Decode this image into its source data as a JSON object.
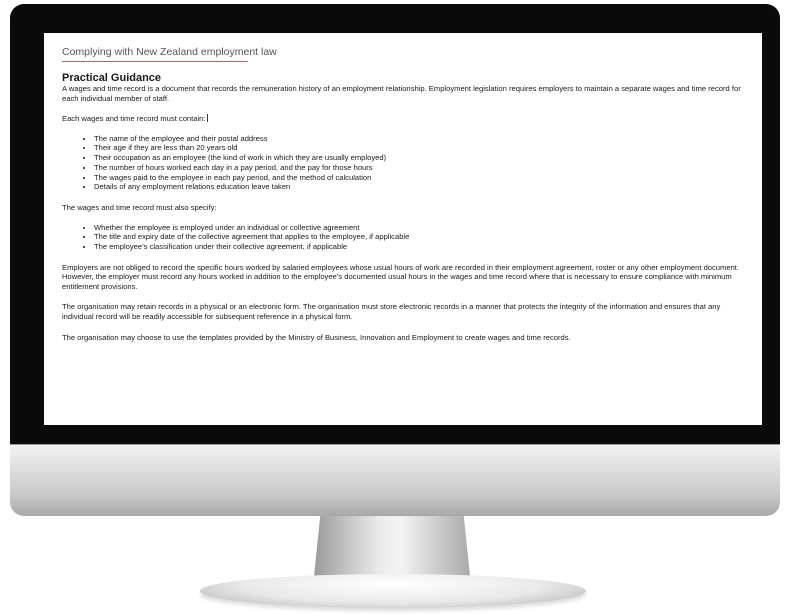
{
  "document": {
    "header": "Complying with New Zealand employment law",
    "section_title": "Practical Guidance",
    "intro": "A wages and time record is a document that records the remuneration history of an employment relationship. Employment legislation requires employers to maintain a separate wages and time record for each individual member of staff.",
    "contain_heading": "Each wages and time record must contain:",
    "contain_items": [
      "The name of the employee and their postal address",
      "Their age if they are less than 20 years old",
      "Their occupation as an employee (the kind of work in which they are usually employed)",
      "The number of hours worked each day in a pay period, and the pay for those hours",
      "The wages paid to the employee in each pay period, and the method of calculation",
      "Details of any employment relations education leave taken"
    ],
    "specify_heading": "The wages and time record must also specify:",
    "specify_items": [
      "Whether the employee is employed under an individual or collective agreement",
      "The title and expiry date of the collective agreement that applies to the employee, if applicable",
      "The employee’s classification under their collective agreement, if applicable"
    ],
    "para_employers": "Employers are not obliged to record the specific hours worked by salaried employees whose usual hours of work are recorded in their employment agreement, roster or any other employment document. However, the employer must record any hours worked in addition to the employee’s documented usual hours in the wages and time record where that is necessary to ensure compliance with minimum entitlement provisions.",
    "para_records": "The organisation may retain records in a physical or an electronic form. The organisation must store electronic records in a manner that protects the integrity of the information and ensures that any individual record will be readily accessible for subsequent reference in a physical form.",
    "para_templates": "The organisation may choose to use the templates provided by the Ministry of Business, Innovation and Employment to create wages and time records."
  },
  "colors": {
    "accent_rule": "#d9534f",
    "bezel": "#0a0a0a",
    "text": "#1a1a1a"
  }
}
